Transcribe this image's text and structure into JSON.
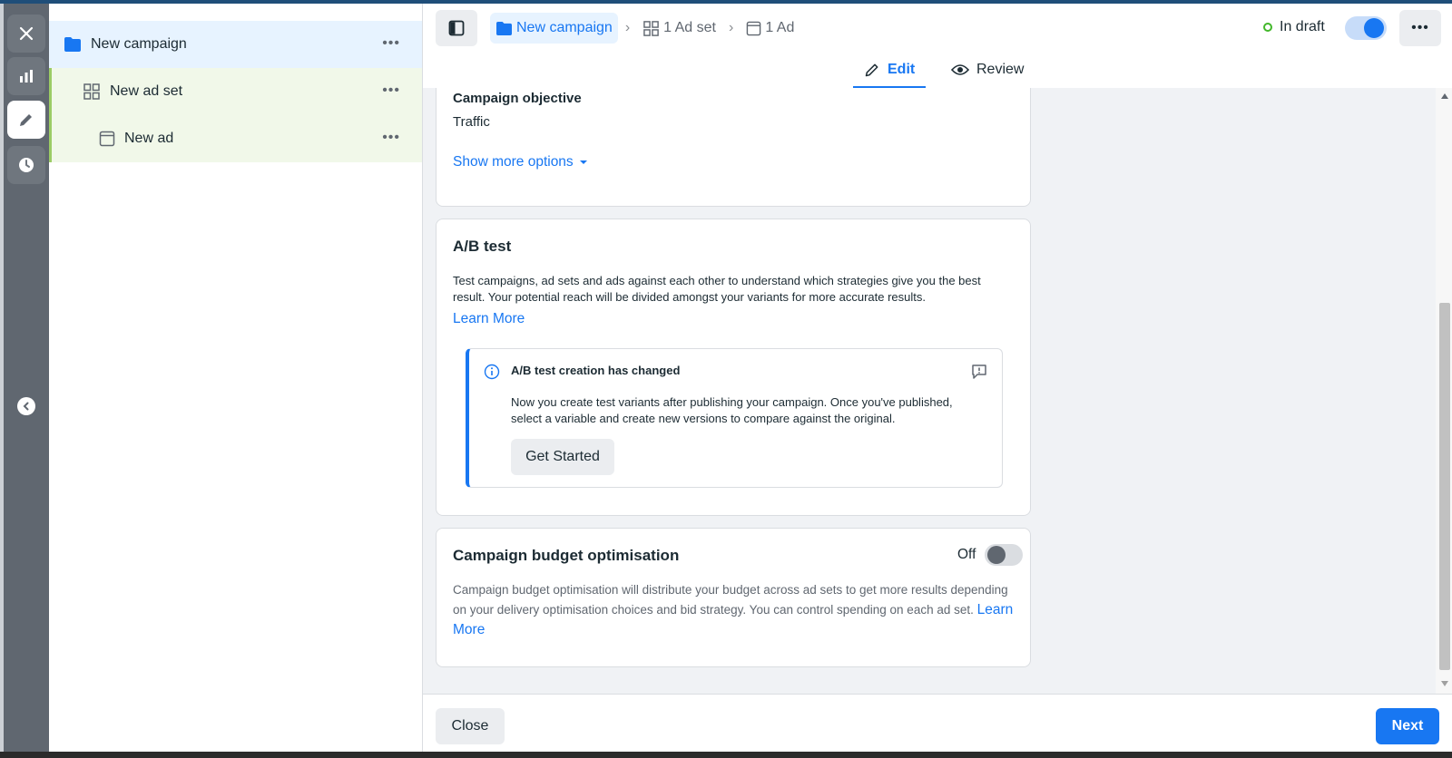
{
  "colors": {
    "accent": "#1877f2",
    "rail": "#606770",
    "draft_dot": "#42b72a",
    "tree_highlight": "#e7f3ff",
    "tree_child": "#f1f8e9"
  },
  "rail": {
    "icons": [
      "close-icon",
      "chart-icon",
      "pencil-icon",
      "clock-icon",
      "chevron-left-icon"
    ]
  },
  "tree": {
    "campaign": {
      "label": "New campaign",
      "more": "•••"
    },
    "adset": {
      "label": "New ad set",
      "more": "•••"
    },
    "ad": {
      "label": "New ad",
      "more": "•••"
    }
  },
  "topbar": {
    "breadcrumbs": [
      "New campaign",
      "1 Ad set",
      "1 Ad"
    ],
    "status": "In draft",
    "status_toggle_on": true,
    "more": "•••",
    "tabs": [
      {
        "label": "Edit",
        "active": true
      },
      {
        "label": "Review",
        "active": false
      }
    ]
  },
  "objective": {
    "heading": "Campaign objective",
    "value": "Traffic",
    "show_more": "Show more options"
  },
  "ab_test": {
    "heading": "A/B test",
    "description": "Test campaigns, ad sets and ads against each other to understand which strategies give you the best result. Your potential reach will be divided amongst your variants for more accurate results.",
    "learn_more": "Learn More",
    "notice": {
      "title": "A/B test creation has changed",
      "text": "Now you create test variants after publishing your campaign. Once you've published, select a variable and create new versions to compare against the original.",
      "button": "Get Started"
    }
  },
  "budget": {
    "heading": "Campaign budget optimisation",
    "toggle_label": "Off",
    "toggle_on": false,
    "description": "Campaign budget optimisation will distribute your budget across ad sets to get more results depending on your delivery optimisation choices and bid strategy. You can control spending on each ad set.",
    "learn_more": "Learn More"
  },
  "footer": {
    "close": "Close",
    "next": "Next"
  }
}
